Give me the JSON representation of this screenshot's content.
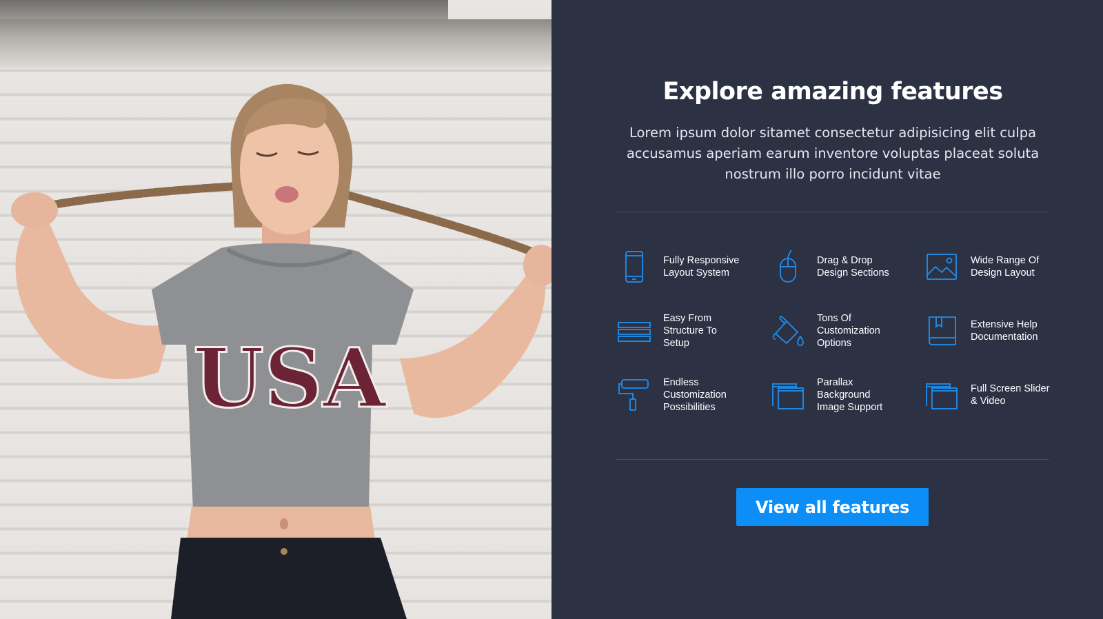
{
  "section": {
    "title": "Explore amazing features",
    "description": "Lorem ipsum dolor sitamet consectetur adipisicing elit culpa accusamus aperiam earum inventore voluptas placeat soluta nostrum illo porro incidunt vitae",
    "cta_label": "View all features"
  },
  "photo": {
    "shirt_text": "USA"
  },
  "features": [
    {
      "label": "Fully Responsive\nLayout System",
      "icon": "mobile-phone-icon"
    },
    {
      "label": "Drag & Drop\nDesign Sections",
      "icon": "mouse-icon"
    },
    {
      "label": "Wide Range Of\nDesign Layout",
      "icon": "image-icon"
    },
    {
      "label": "Easy From\nStructure To\nSetup",
      "icon": "layers-icon"
    },
    {
      "label": "Tons Of\nCustomization\nOptions",
      "icon": "paint-bucket-icon"
    },
    {
      "label": "Extensive Help\nDocumentation",
      "icon": "book-icon"
    },
    {
      "label": "Endless\nCustomization\nPossibilities",
      "icon": "paint-roller-icon"
    },
    {
      "label": "Parallax\nBackground\nImage Support",
      "icon": "windows-icon"
    },
    {
      "label": "Full Screen Slider\n& Video",
      "icon": "windows-icon"
    }
  ],
  "colors": {
    "panel_bg": "#2d3144",
    "accent": "#0d8ef7",
    "icon_stroke": "#1e90f0",
    "text": "#ffffff"
  }
}
